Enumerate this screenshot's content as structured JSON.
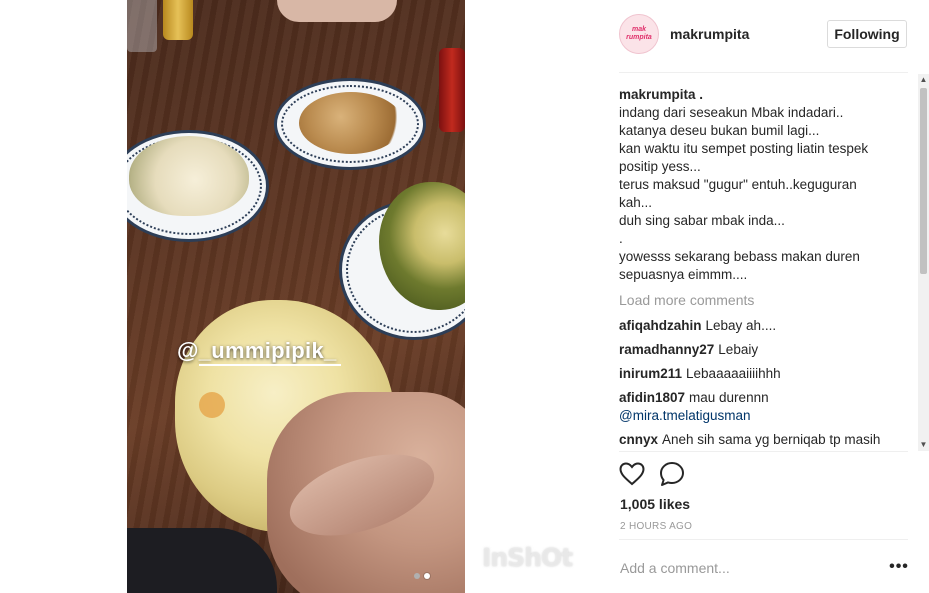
{
  "post": {
    "username": "makrumpita",
    "avatar_text": [
      "mak",
      "rumpita"
    ],
    "follow_label": "Following",
    "overlay_tag": "@_ummipipik_",
    "watermark": "InShOt",
    "carousel": {
      "count": 2,
      "active_index": 1
    }
  },
  "caption": {
    "user": "makrumpita .",
    "lines": [
      "indang dari seseakun Mbak indadari..",
      "katanya deseu bukan bumil lagi...",
      "kan waktu itu sempet posting liatin tespek",
      "positip yess...",
      "terus maksud \"gugur\" entuh..keguguran",
      "kah...",
      "duh sing sabar mbak inda...",
      ".",
      "yowesss sekarang bebass makan duren",
      "sepuasnya eimmm...."
    ]
  },
  "load_more_label": "Load more comments",
  "comments": [
    {
      "user": "afiqahdzahin",
      "text": "Lebay ah...."
    },
    {
      "user": "ramadhanny27",
      "text": "Lebaiy"
    },
    {
      "user": "inirum211",
      "text": "Lebaaaaaiiiihhh"
    },
    {
      "user": "afidin1807",
      "text": "mau durennn",
      "mention": "@mira.tmelatigusman"
    },
    {
      "user": "cnnyx",
      "text": "Aneh sih sama yg berniqab tp masih"
    }
  ],
  "actions": {
    "like_icon": "heart-icon",
    "comment_icon": "speech-bubble-icon"
  },
  "likes_text": "1,005 likes",
  "timestamp": "2 HOURS AGO",
  "add_comment_placeholder": "Add a comment...",
  "more_options_glyph": "•••",
  "scrollbar": {
    "up_glyph": "▲",
    "down_glyph": "▼"
  },
  "colors": {
    "mention": "#003569",
    "muted": "#999999",
    "text": "#262626",
    "border": "#dbdbdb"
  }
}
